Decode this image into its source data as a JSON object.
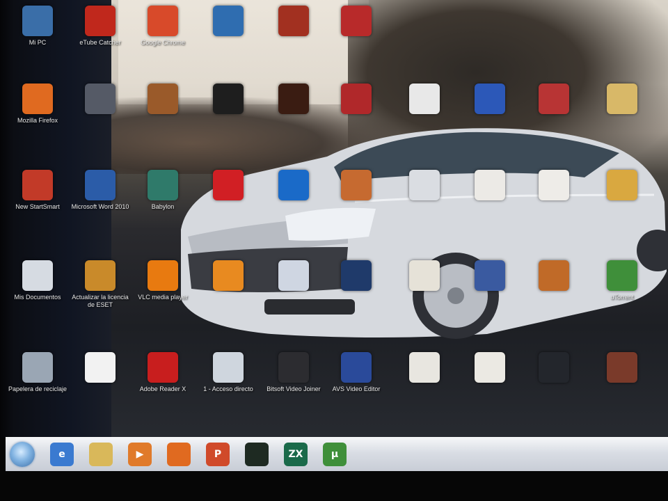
{
  "desktop": {
    "icons": [
      {
        "label": "Mi PC",
        "icon": "computer-icon",
        "color": "#3a6ea8"
      },
      {
        "label": "eTube Catcher",
        "icon": "etube-icon",
        "color": "#c0281c"
      },
      {
        "label": "Google Chrome",
        "icon": "chrome-icon",
        "color": "#d84a2a"
      },
      {
        "label": "",
        "icon": "app-icon",
        "color": "#2f6db0"
      },
      {
        "label": "",
        "icon": "app-icon",
        "color": "#a23020"
      },
      {
        "label": "",
        "icon": "app-icon",
        "color": "#b82a2a"
      },
      {
        "label": "Mozilla Firefox",
        "icon": "firefox-icon",
        "color": "#e06a20"
      },
      {
        "label": "",
        "icon": "shortcut-icon",
        "color": "#555a66"
      },
      {
        "label": "",
        "icon": "app-icon",
        "color": "#9a5a2a"
      },
      {
        "label": "",
        "icon": "image-icon",
        "color": "#1e1e1e"
      },
      {
        "label": "",
        "icon": "image-icon",
        "color": "#3a1c12"
      },
      {
        "label": "",
        "icon": "app-icon",
        "color": "#b0282a"
      },
      {
        "label": "",
        "icon": "document-icon",
        "color": "#e8e8e8"
      },
      {
        "label": "",
        "icon": "app-icon",
        "color": "#2c58b8"
      },
      {
        "label": "",
        "icon": "app-icon",
        "color": "#b83434"
      },
      {
        "label": "",
        "icon": "folder-icon",
        "color": "#d8b868"
      },
      {
        "label": "",
        "icon": "app-icon",
        "color": "#5a5a60"
      },
      {
        "label": "",
        "icon": "app-icon",
        "color": "#c2302a"
      },
      {
        "label": "New StartSmart",
        "icon": "nero-icon",
        "color": "#c23a28"
      },
      {
        "label": "Microsoft Word 2010",
        "icon": "word-icon",
        "color": "#2b5ca8"
      },
      {
        "label": "Babylon",
        "icon": "babylon-icon",
        "color": "#2f7a6a"
      },
      {
        "label": "",
        "icon": "avira-icon",
        "color": "#d11f24"
      },
      {
        "label": "",
        "icon": "music-icon",
        "color": "#1a6ac8"
      },
      {
        "label": "",
        "icon": "media-icon",
        "color": "#c66a30"
      },
      {
        "label": "",
        "icon": "app-icon",
        "color": "#dadde2"
      },
      {
        "label": "",
        "icon": "document-icon",
        "color": "#eceae6"
      },
      {
        "label": "",
        "icon": "document-icon",
        "color": "#eeece8"
      },
      {
        "label": "",
        "icon": "folder-icon",
        "color": "#d9a840"
      },
      {
        "label": "Mis Documentos",
        "icon": "documents-icon",
        "color": "#d6dbe2"
      },
      {
        "label": "Actualizar la licencia de ESET",
        "icon": "eset-icon",
        "color": "#c98a2a"
      },
      {
        "label": "VLC media player",
        "icon": "vlc-icon",
        "color": "#e87a10"
      },
      {
        "label": "",
        "icon": "vlc-icon",
        "color": "#e88a20"
      },
      {
        "label": "",
        "icon": "app-icon",
        "color": "#cfd6e2"
      },
      {
        "label": "",
        "icon": "gear-icon",
        "color": "#1f3a6a"
      },
      {
        "label": "",
        "icon": "document-icon",
        "color": "#e6e2d8"
      },
      {
        "label": "",
        "icon": "app-icon",
        "color": "#3a5aa0"
      },
      {
        "label": "",
        "icon": "app-icon",
        "color": "#c06a28"
      },
      {
        "label": "uTorrent",
        "icon": "utorrent-icon",
        "color": "#3f8f3a"
      },
      {
        "label": "Papelera de reciclaje",
        "icon": "recycle-bin-icon",
        "color": "#9aa6b4"
      },
      {
        "label": "",
        "icon": "document-icon",
        "color": "#f2f2f2"
      },
      {
        "label": "Adobe Reader X",
        "icon": "adobe-reader-icon",
        "color": "#c81e1e"
      },
      {
        "label": "1 - Acceso directo",
        "icon": "shortcut-icon",
        "color": "#cfd6de"
      },
      {
        "label": "Bitsoft Video Joiner",
        "icon": "video-joiner-icon",
        "color": "#2c2c30"
      },
      {
        "label": "AVS Video Editor",
        "icon": "avs-icon",
        "color": "#2a4a9a"
      },
      {
        "label": "",
        "icon": "document-icon",
        "color": "#e8e6e0"
      },
      {
        "label": "",
        "icon": "document-icon",
        "color": "#ebe9e3"
      },
      {
        "label": "",
        "icon": "video-icon",
        "color": "#23262c"
      },
      {
        "label": "",
        "icon": "photo-icon",
        "color": "#7a3a2a"
      }
    ]
  },
  "taskbar": {
    "items": [
      {
        "icon": "start-orb-icon",
        "text": ""
      },
      {
        "icon": "internet-explorer-icon",
        "text": "e",
        "color": "#3a7ad0"
      },
      {
        "icon": "folder-icon",
        "text": "",
        "color": "#d9b85a"
      },
      {
        "icon": "media-player-icon",
        "text": "▶",
        "color": "#e07a2a"
      },
      {
        "icon": "firefox-icon",
        "text": "",
        "color": "#e06a20"
      },
      {
        "icon": "powerpoint-icon",
        "text": "P",
        "color": "#d04a2a"
      },
      {
        "icon": "xbox-icon",
        "text": "",
        "color": "#1e2a22"
      },
      {
        "icon": "app-icon",
        "text": "ZX",
        "color": "#1a6a4a"
      },
      {
        "icon": "utorrent-icon",
        "text": "µ",
        "color": "#3f8f3a"
      }
    ]
  },
  "colors": {
    "taskbar": "#d9dde4",
    "car": "#d8dade"
  }
}
